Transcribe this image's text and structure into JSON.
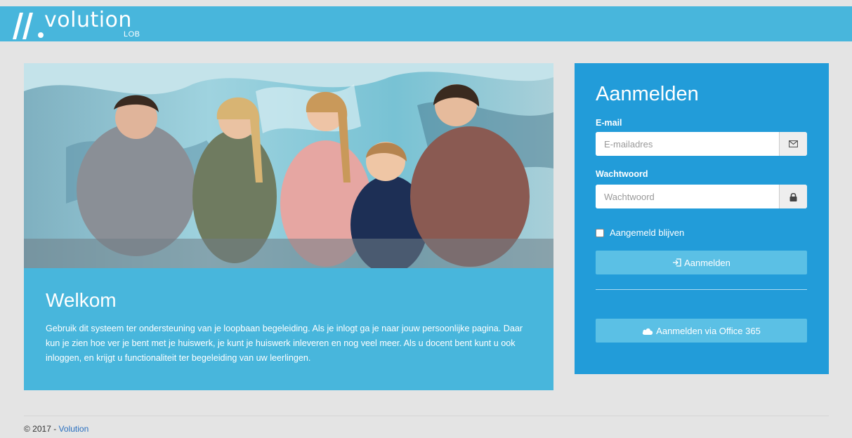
{
  "header": {
    "logo_text": "volution",
    "logo_sub": "LOB"
  },
  "welcome": {
    "title": "Welkom",
    "text": "Gebruik dit systeem ter ondersteuning van je loopbaan begeleiding. Als je inlogt ga je naar jouw persoonlijke pagina. Daar kun je zien hoe ver je bent met je huiswerk, je kunt je huiswerk inleveren en nog veel meer. Als u docent bent kunt u ook inloggen, en krijgt u functionaliteit ter begeleiding van uw leerlingen."
  },
  "login": {
    "title": "Aanmelden",
    "email_label": "E-mail",
    "email_placeholder": "E-mailadres",
    "email_value": "",
    "password_label": "Wachtwoord",
    "password_placeholder": "Wachtwoord",
    "password_value": "",
    "remember_label": "Aangemeld blijven",
    "remember_checked": false,
    "submit_label": "Aanmelden",
    "office_label": "Aanmelden via Office 365"
  },
  "footer": {
    "copyright": "© 2017 - ",
    "link": "Volution"
  },
  "colors": {
    "header": "#48b6dc",
    "login_panel": "#229cd9",
    "button": "#5bc0e5",
    "background": "#e4e4e4"
  },
  "icons": {
    "email_addon": "envelope-icon",
    "password_addon": "lock-icon",
    "submit": "sign-in-icon",
    "office": "cloud-icon"
  }
}
